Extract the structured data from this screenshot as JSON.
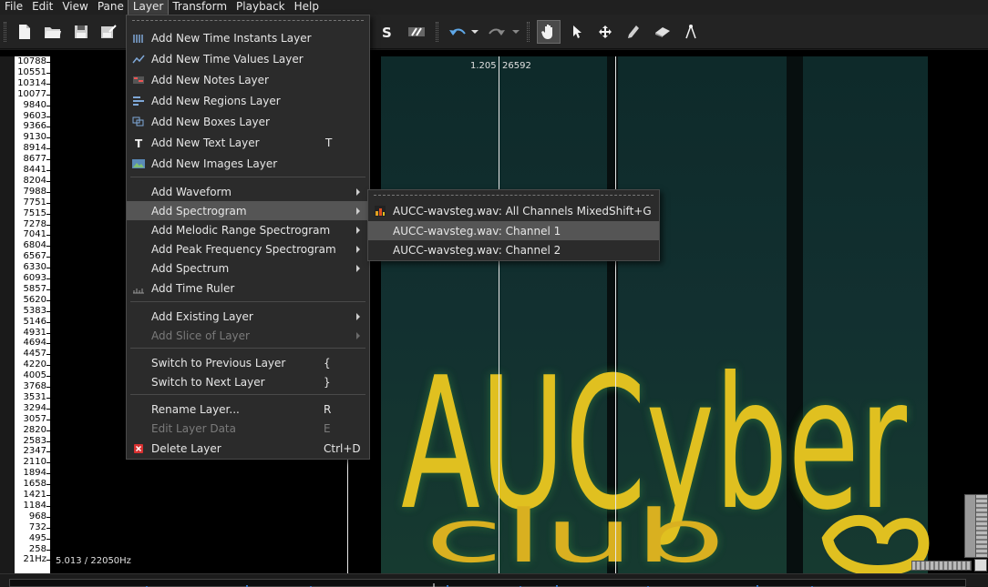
{
  "menubar": {
    "items": [
      "File",
      "Edit",
      "View",
      "Pane",
      "Layer",
      "Transform",
      "Playback",
      "Help"
    ],
    "active": "Layer"
  },
  "icons": {
    "toolbar": [
      "new-file-icon",
      "open-folder-icon",
      "save-icon",
      "save-as-icon",
      "solo-icon",
      "align-icon",
      "undo-icon",
      "dropdown-icon",
      "redo-icon",
      "dropdown-icon",
      "navigate-hand-icon",
      "select-cursor-icon",
      "move-icon",
      "draw-pencil-icon",
      "erase-icon",
      "measure-icon"
    ]
  },
  "layer_menu": {
    "items": [
      {
        "label": "Add New Time Instants Layer",
        "shortcut": "",
        "icon": "time-instants-icon"
      },
      {
        "label": "Add New Time Values Layer",
        "shortcut": "",
        "icon": "time-values-icon"
      },
      {
        "label": "Add New Notes Layer",
        "shortcut": "",
        "icon": "notes-icon"
      },
      {
        "label": "Add New Regions Layer",
        "shortcut": "",
        "icon": "regions-icon"
      },
      {
        "label": "Add New Boxes Layer",
        "shortcut": "",
        "icon": "boxes-icon"
      },
      {
        "label": "Add New Text Layer",
        "shortcut": "T",
        "icon": "text-icon"
      },
      {
        "label": "Add New Images Layer",
        "shortcut": "",
        "icon": "image-icon"
      },
      {
        "label": "Add Waveform",
        "submenu": true
      },
      {
        "label": "Add Spectrogram",
        "submenu": true,
        "highlight": true
      },
      {
        "label": "Add Melodic Range Spectrogram",
        "submenu": true
      },
      {
        "label": "Add Peak Frequency Spectrogram",
        "submenu": true
      },
      {
        "label": "Add Spectrum",
        "submenu": true
      },
      {
        "label": "Add Time Ruler",
        "icon": "time-ruler-icon"
      },
      {
        "label": "Add Existing Layer",
        "submenu": true
      },
      {
        "label": "Add Slice of Layer",
        "submenu": true,
        "disabled": true
      },
      {
        "label": "Switch to Previous Layer",
        "shortcut": "{"
      },
      {
        "label": "Switch to Next Layer",
        "shortcut": "}"
      },
      {
        "label": "Rename Layer...",
        "shortcut": "R"
      },
      {
        "label": "Edit Layer Data",
        "shortcut": "E",
        "disabled": true
      },
      {
        "label": "Delete Layer",
        "shortcut": "Ctrl+D",
        "icon": "delete-icon"
      }
    ]
  },
  "spectrogram_submenu": {
    "items": [
      {
        "label": "AUCC-wavsteg.wav: All Channels Mixed",
        "shortcut": "Shift+G",
        "icon": "spectrogram-icon"
      },
      {
        "label": "AUCC-wavsteg.wav: Channel 1",
        "shortcut": "",
        "highlight": true
      },
      {
        "label": "AUCC-wavsteg.wav: Channel 2",
        "shortcut": ""
      }
    ]
  },
  "vertical_scale": {
    "ticks": [
      "10788",
      "10551",
      "10314",
      "10077",
      "9840",
      "9603",
      "9366",
      "9130",
      "8914",
      "8677",
      "8441",
      "8204",
      "7988",
      "7751",
      "7515",
      "7278",
      "7041",
      "6804",
      "6567",
      "6330",
      "6093",
      "5857",
      "5620",
      "5383",
      "5146",
      "4931",
      "4694",
      "4457",
      "4220",
      "4005",
      "3768",
      "3531",
      "3294",
      "3057",
      "2820",
      "2583",
      "2347",
      "2110",
      "1894",
      "1658",
      "1421",
      "1184",
      "968",
      "732",
      "495",
      "258",
      "21Hz"
    ]
  },
  "readouts": {
    "cursor_time": "1.205",
    "cursor_frame": "26592",
    "scale_info": "5.013 / 22050Hz"
  },
  "spectrogram": {
    "text_line1": "AUCyber",
    "text_line2": "club",
    "colors": {
      "background": "#0c2020",
      "text": "#e0c020",
      "glow": "#2d7a3a"
    }
  }
}
